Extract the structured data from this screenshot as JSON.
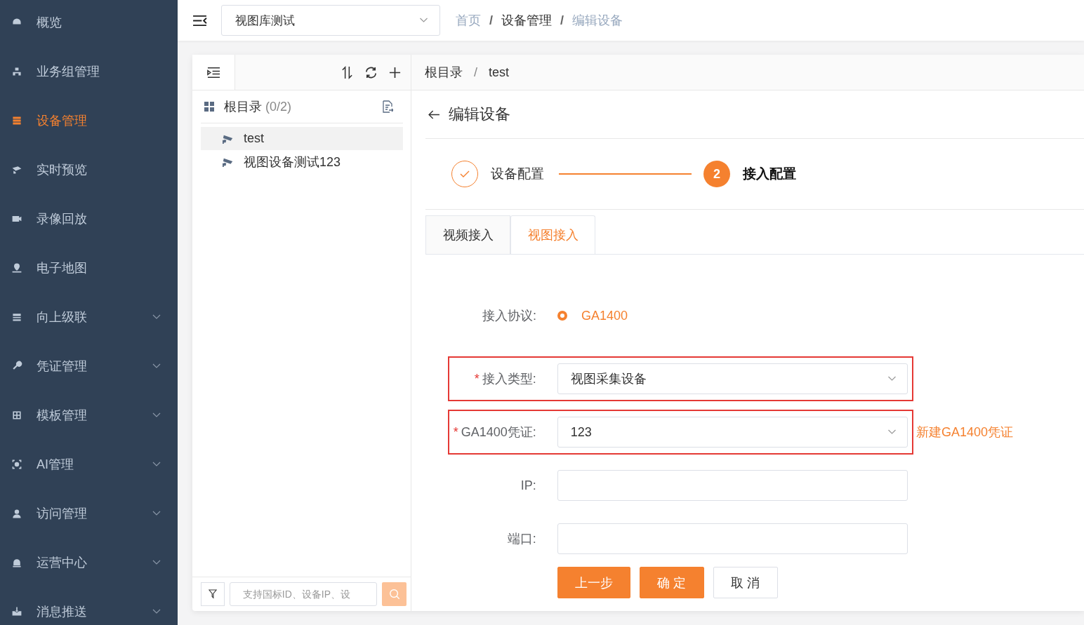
{
  "sidebar": {
    "items": [
      {
        "label": "概览",
        "selected": false,
        "expandable": false
      },
      {
        "label": "业务组管理",
        "selected": false,
        "expandable": false
      },
      {
        "label": "设备管理",
        "selected": true,
        "expandable": false
      },
      {
        "label": "实时预览",
        "selected": false,
        "expandable": false
      },
      {
        "label": "录像回放",
        "selected": false,
        "expandable": false
      },
      {
        "label": "电子地图",
        "selected": false,
        "expandable": false
      },
      {
        "label": "向上级联",
        "selected": false,
        "expandable": true
      },
      {
        "label": "凭证管理",
        "selected": false,
        "expandable": true
      },
      {
        "label": "模板管理",
        "selected": false,
        "expandable": true
      },
      {
        "label": "AI管理",
        "selected": false,
        "expandable": true
      },
      {
        "label": "访问管理",
        "selected": false,
        "expandable": true
      },
      {
        "label": "运营中心",
        "selected": false,
        "expandable": true
      },
      {
        "label": "消息推送",
        "selected": false,
        "expandable": true
      }
    ]
  },
  "header": {
    "project_select": {
      "value": "视图库测试"
    },
    "breadcrumb": [
      "首页",
      "设备管理",
      "编辑设备"
    ],
    "separator": "/"
  },
  "tree_panel": {
    "root": {
      "label": "根目录",
      "count": "(0/2)",
      "children": [
        {
          "label": "test",
          "selected": true
        },
        {
          "label": "视图设备测试123",
          "selected": false
        }
      ]
    },
    "search": {
      "placeholder": "支持国标ID、设备IP、设"
    }
  },
  "content": {
    "path": [
      "根目录",
      "test"
    ],
    "separator": "/",
    "title": "编辑设备",
    "steps": [
      {
        "label": "设备配置",
        "completed": true
      },
      {
        "label": "接入配置",
        "completed": false,
        "number": "2"
      }
    ],
    "tabs": [
      {
        "label": "视频接入",
        "selected": false
      },
      {
        "label": "视图接入",
        "selected": true
      }
    ],
    "fields": [
      {
        "kind": "radio",
        "label": "接入协议:",
        "highlighted": false,
        "options": [
          {
            "label": "GA1400",
            "selected": true
          }
        ]
      },
      {
        "kind": "select",
        "label": "接入类型:",
        "required_mark": "*",
        "highlighted": true,
        "value": "视图采集设备"
      },
      {
        "kind": "select",
        "label": "GA1400凭证:",
        "required_mark": "*",
        "highlighted": true,
        "value": "123",
        "link": "新建GA1400凭证"
      },
      {
        "kind": "input",
        "label": "IP:",
        "highlighted": false
      },
      {
        "kind": "input",
        "label": "端口:",
        "highlighted": false
      }
    ],
    "buttons": [
      {
        "label": "上一步",
        "kind": "primary"
      },
      {
        "label": "确 定",
        "kind": "primary"
      },
      {
        "label": "取 消",
        "kind": "default"
      }
    ]
  }
}
